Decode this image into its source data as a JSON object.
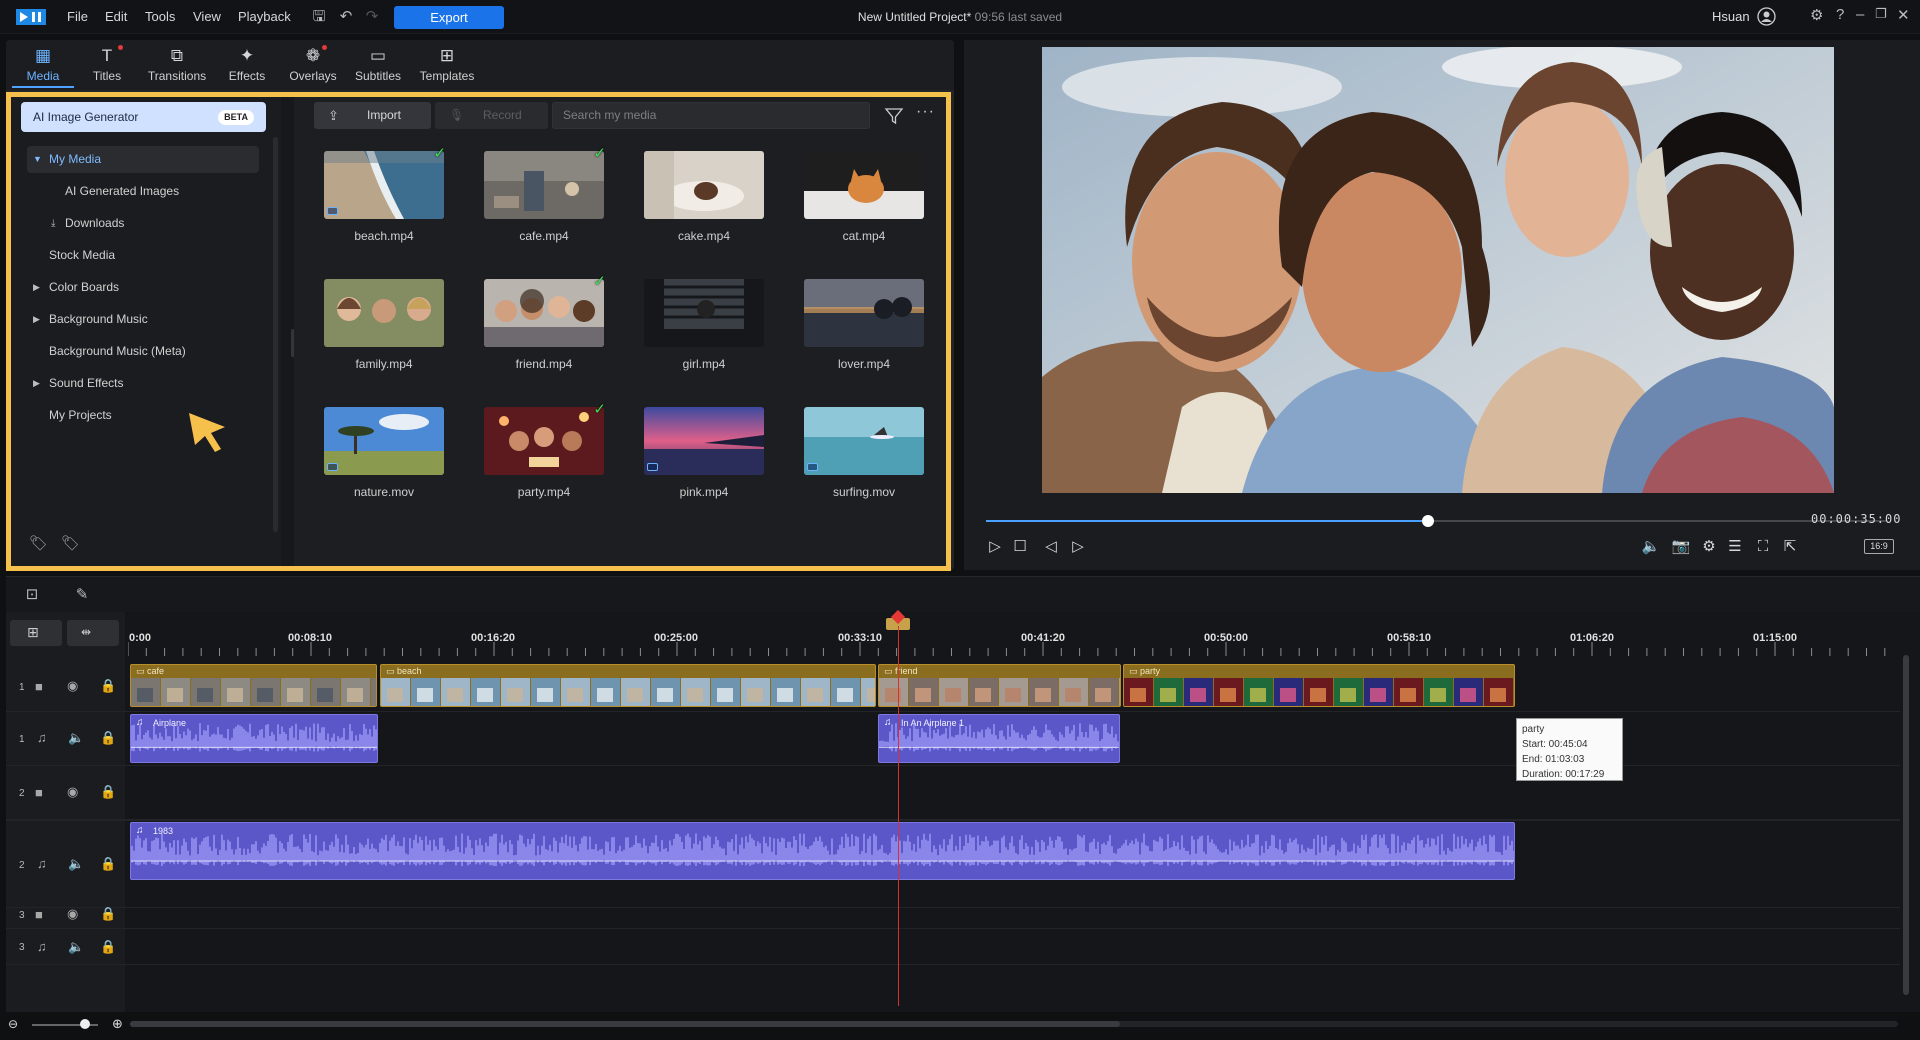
{
  "app": {
    "menu": [
      "File",
      "Edit",
      "Tools",
      "View",
      "Playback"
    ],
    "export_label": "Export",
    "project_title": "New Untitled Project*",
    "saved_text": "09:56 last saved",
    "user_name": "Hsuan"
  },
  "library": {
    "tabs": [
      {
        "label": "Media",
        "icon": "media-icon",
        "active": true
      },
      {
        "label": "Titles",
        "icon": "titles-icon"
      },
      {
        "label": "Transitions",
        "icon": "transitions-icon"
      },
      {
        "label": "Effects",
        "icon": "effects-icon"
      },
      {
        "label": "Overlays",
        "icon": "overlays-icon"
      },
      {
        "label": "Subtitles",
        "icon": "subtitles-icon"
      },
      {
        "label": "Templates",
        "icon": "templates-icon"
      }
    ],
    "ai_generator": {
      "label": "AI Image Generator",
      "badge": "BETA"
    },
    "tree": [
      {
        "label": "My Media",
        "selected": true,
        "arrow": "▼"
      },
      {
        "label": "AI Generated Images"
      },
      {
        "label": "Downloads"
      },
      {
        "label": "Stock Media"
      },
      {
        "label": "Color Boards",
        "arrow": "▶"
      },
      {
        "label": "Background Music",
        "arrow": "▶"
      },
      {
        "label": "Background Music (Meta)"
      },
      {
        "label": "Sound Effects",
        "arrow": "▶"
      },
      {
        "label": "My Projects"
      }
    ],
    "import_label": "Import",
    "record_label": "Record",
    "search_placeholder": "Search my media",
    "media": [
      {
        "name": "beach.mp4",
        "checked": true
      },
      {
        "name": "cafe.mp4",
        "checked": true
      },
      {
        "name": "cake.mp4",
        "checked": false
      },
      {
        "name": "cat.mp4",
        "checked": false
      },
      {
        "name": "family.mp4",
        "checked": false
      },
      {
        "name": "friend.mp4",
        "checked": true
      },
      {
        "name": "girl.mp4",
        "checked": false
      },
      {
        "name": "lover.mp4",
        "checked": false
      },
      {
        "name": "nature.mov",
        "checked": false
      },
      {
        "name": "party.mp4",
        "checked": true
      },
      {
        "name": "pink.mp4",
        "checked": false
      },
      {
        "name": "surfing.mov",
        "checked": false
      }
    ]
  },
  "preview": {
    "timecode": "00:00:35:00",
    "progress": 0.49,
    "aspect_ratio": "16:9"
  },
  "timeline": {
    "ruler_labels": [
      "0:00",
      "00:08:10",
      "00:16:20",
      "00:25:00",
      "00:33:10",
      "00:41:20",
      "00:50:00",
      "00:58:10",
      "01:06:20",
      "01:15:00"
    ],
    "tracks": [
      {
        "number": "1",
        "type": "video"
      },
      {
        "number": "1",
        "type": "audio"
      },
      {
        "number": "2",
        "type": "video"
      },
      {
        "number": "2",
        "type": "audio"
      },
      {
        "number": "3",
        "type": "video"
      },
      {
        "number": "3",
        "type": "audio"
      }
    ],
    "clips": {
      "cafe": "cafe",
      "beach": "beach",
      "friend": "friend",
      "party": "party",
      "airplane": "Airplane",
      "in_an_airplane": "In An Airplane 1",
      "song_1983": "1983"
    },
    "tooltip": {
      "title": "party",
      "start": "Start: 00:45:04",
      "end": "End: 01:03:03",
      "duration": "Duration: 00:17:29"
    }
  },
  "colors": {
    "accent": "#1a73e8",
    "highlight_frame": "#f6c04d",
    "video_clip": "#8a6d1e",
    "audio_clip": "#5b57c9",
    "playhead": "#d8322f"
  }
}
